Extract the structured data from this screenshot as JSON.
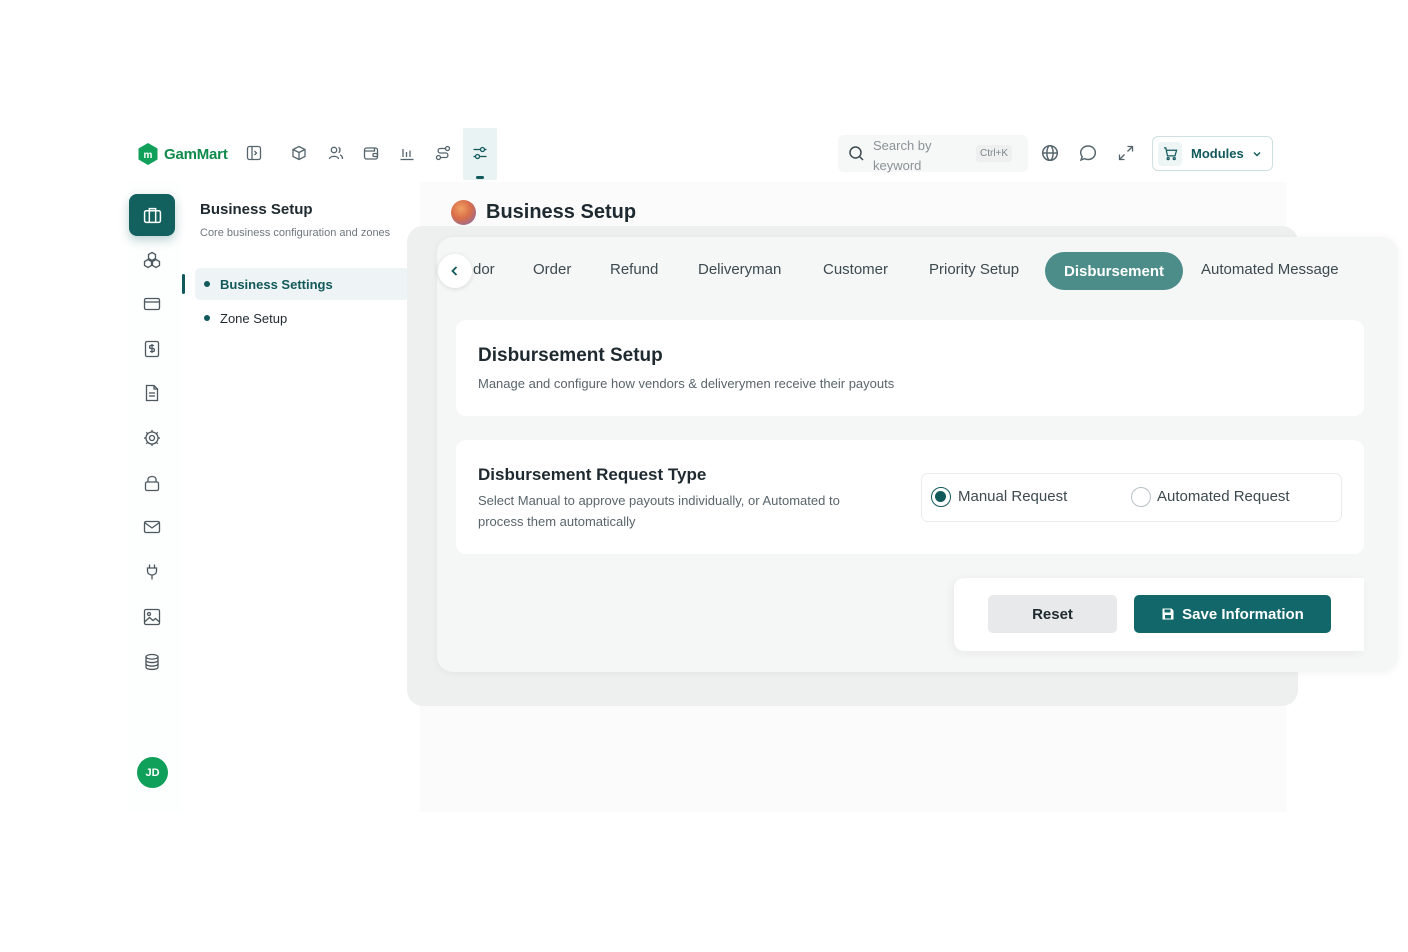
{
  "brand": {
    "name": "GamMart",
    "color": "#0f8a4b"
  },
  "topbar": {
    "icons": [
      "sidebar-toggle-icon",
      "package-icon",
      "users-icon",
      "wallet-icon",
      "bar-chart-icon",
      "route-icon",
      "settings-sliders-icon"
    ],
    "search": {
      "placeholder": "Search by keyword",
      "shortcut": "Ctrl+K"
    },
    "modules_label": "Modules"
  },
  "rail": {
    "items": [
      "business-icon",
      "modules-icon",
      "card-icon",
      "dollar-icon",
      "document-icon",
      "gear-icon",
      "lock-icon",
      "mail-icon",
      "plug-icon",
      "image-icon",
      "database-icon"
    ],
    "avatar_initials": "JD"
  },
  "sub_sidebar": {
    "title": "Business Setup",
    "caption": "Core business configuration and zones",
    "items": [
      {
        "label": "Business Settings",
        "active": true
      },
      {
        "label": "Zone Setup",
        "active": false
      }
    ]
  },
  "main": {
    "title": "Business Setup",
    "tabs": [
      {
        "label": "dor"
      },
      {
        "label": "Order"
      },
      {
        "label": "Refund"
      },
      {
        "label": "Deliveryman"
      },
      {
        "label": "Customer"
      },
      {
        "label": "Priority Setup"
      },
      {
        "label": "Disbursement",
        "active": true
      },
      {
        "label": "Automated Message"
      }
    ],
    "setup_card": {
      "title": "Disbursement Setup",
      "description": "Manage and configure how vendors & deliverymen receive their payouts"
    },
    "request_card": {
      "title": "Disbursement Request Type",
      "description_line1": "Select Manual to approve payouts individually, or Automated to",
      "description_line2": "process them automatically",
      "options": [
        {
          "label": "Manual Request",
          "selected": true
        },
        {
          "label": "Automated Request",
          "selected": false
        }
      ]
    },
    "actions": {
      "reset": "Reset",
      "save": "Save Information"
    }
  },
  "colors": {
    "primary": "#12595b",
    "active_tab": "#4c8d89",
    "save_button": "#12676a"
  }
}
